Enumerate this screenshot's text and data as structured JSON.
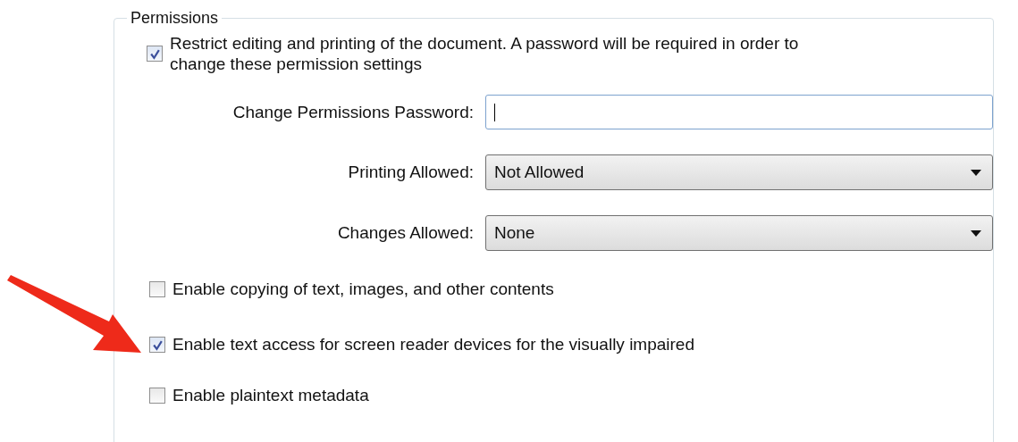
{
  "group": {
    "title": "Permissions"
  },
  "restrict": {
    "label": "Restrict editing and printing of the document. A password will be required in order to change these permission settings",
    "checked": true
  },
  "fields": [
    {
      "kind": "text",
      "label": "Change Permissions Password:",
      "focused": true
    },
    {
      "kind": "select",
      "label": "Printing Allowed:",
      "value": "Not Allowed"
    },
    {
      "kind": "select",
      "label": "Changes Allowed:",
      "value": "None"
    }
  ],
  "options": [
    {
      "label": "Enable copying of text, images, and other contents",
      "checked": false
    },
    {
      "label": "Enable text access for screen reader devices for the visually impaired",
      "checked": true
    },
    {
      "label": "Enable plaintext metadata",
      "checked": false
    }
  ]
}
